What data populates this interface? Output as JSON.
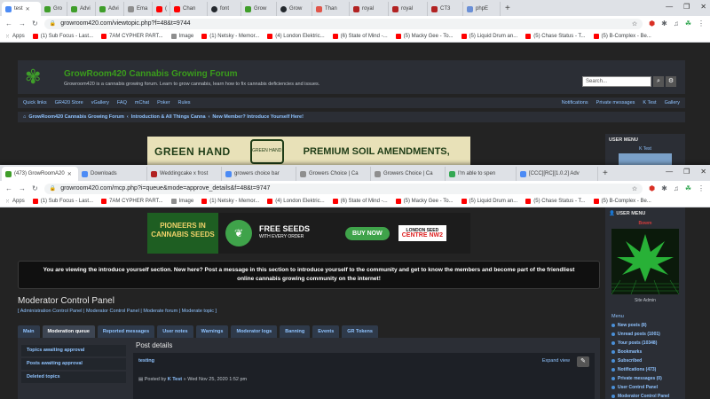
{
  "back_window": {
    "tabs": [
      {
        "label": "test",
        "active": true,
        "color": "#4c8bf5"
      },
      {
        "label": "Gro",
        "color": "#3f9e2a"
      },
      {
        "label": "Advi",
        "color": "#3f9e2a"
      },
      {
        "label": "Advi",
        "color": "#3f9e2a"
      },
      {
        "label": "Ema",
        "color": "#8e8e8e"
      },
      {
        "label": "(",
        "color": "#ff0000"
      },
      {
        "label": "Chan",
        "color": "#ff0000"
      },
      {
        "label": "font",
        "color": "#24292e"
      },
      {
        "label": "Grow",
        "color": "#3f9e2a"
      },
      {
        "label": "Grow",
        "color": "#24292e"
      },
      {
        "label": "Than",
        "color": "#e0554a"
      },
      {
        "label": "royal",
        "color": "#b22222"
      },
      {
        "label": "royal",
        "color": "#b22222"
      },
      {
        "label": "CT3",
        "color": "#b22222"
      },
      {
        "label": "phpE",
        "color": "#6a8fd6"
      }
    ],
    "url": "growroom420.com/viewtopic.php?f=48&t=9744",
    "forum": {
      "title": "GrowRoom420 Cannabis Growing Forum",
      "description": "Growroom420 is a cannabis growing forum. Learn to grow cannabis, learn how to fix cannabis deficiencies and issues.",
      "search_placeholder": "Search...",
      "nav_left": [
        "Quick links",
        "GR420 Store",
        "vGallery",
        "FAQ",
        "mChat",
        "Poker",
        "Rules"
      ],
      "nav_right": [
        "Notifications",
        "Private messages",
        "K Test",
        "Gallery"
      ],
      "breadcrumb": [
        "GrowRoom420 Cannabis Growing Forum",
        "Introduction & All Things Canna",
        "New Member? Introduce Yourself Here!"
      ],
      "banner_left": "GREEN HAND",
      "banner_logo": "GREEN HAND",
      "banner_right": "PREMIUM SOIL AMENDMENTS,",
      "user_menu": "USER MENU",
      "user_name": "K Test"
    }
  },
  "front_window": {
    "tabs": [
      {
        "label": "(473) GrowRoomA20",
        "active": true,
        "color": "#3f9e2a"
      },
      {
        "label": "Downloads",
        "color": "#4c8bf5"
      },
      {
        "label": "Weddingcake x frost",
        "color": "#b22222"
      },
      {
        "label": "growers choice bar",
        "color": "#4c8bf5"
      },
      {
        "label": "Growers Choice | Ca",
        "color": "#8e8e8e"
      },
      {
        "label": "Growers Choice | Ca",
        "color": "#8e8e8e"
      },
      {
        "label": "I'm able to spen",
        "color": "#34a853"
      },
      {
        "label": "[CCC][RC][1.0.2] Adv",
        "color": "#4c8bf5"
      }
    ],
    "url": "growroom420.com/mcp.php?i=queue&mode=approve_details&f=48&t=9747"
  },
  "bookmarks": [
    "Apps",
    "(1) Sub Focus - Last...",
    "7AM CYPHER PART...",
    "Image",
    "(1) Netsky - Memor...",
    "(4) London Elektric...",
    "(6) State of Mind -...",
    "(5) Macky Gee - To...",
    "(5) Liquid Drum an...",
    "(5) Chase Status - T...",
    "(5) B-Complex - Be..."
  ],
  "banner": {
    "left_text": "PIONEERS IN CANNABIS SEEDS",
    "free": "FREE SEEDS",
    "free_sub": "WITH EVERY ORDER",
    "buy": "BUY NOW",
    "logo_line1": "LONDON SEED",
    "logo_line2": "CENTRE NW2"
  },
  "announcement": "You are viewing the introduce yourself section. New here? Post a message in this section to introduce yourself to the community and get to know the members and become part of the friendliest online cannabis growing community on the internet!",
  "mcp": {
    "title": "Moderator Control Panel",
    "links": "[ Administration Control Panel | Moderator Control Panel | Moderate forum | Moderate topic ]",
    "tabs": [
      "Main",
      "Moderation queue",
      "Reported messages",
      "User notes",
      "Warnings",
      "Moderator logs",
      "Banning",
      "Events",
      "GR Tokens"
    ],
    "active_tab": 1,
    "side_items": [
      "Topics awaiting approval",
      "Posts awaiting approval",
      "Deleted topics"
    ],
    "post_details_title": "Post details",
    "post_subject": "testing",
    "expand_view": "Expand view",
    "posted_by": "Posted by",
    "author": "K Test",
    "post_date": "» Wed Nov 25, 2020 1:52 pm"
  },
  "sidebar": {
    "title": "USER MENU",
    "rank": "Bowm",
    "role": "Site Admin",
    "menu_label": "Menu",
    "items": [
      "New posts (8)",
      "Unread posts (1001)",
      "Your posts (10348)",
      "Bookmarks",
      "Subscribed",
      "Notifications (473)",
      "Private messages (0)",
      "User Control Panel",
      "Moderator Control Panel"
    ]
  }
}
